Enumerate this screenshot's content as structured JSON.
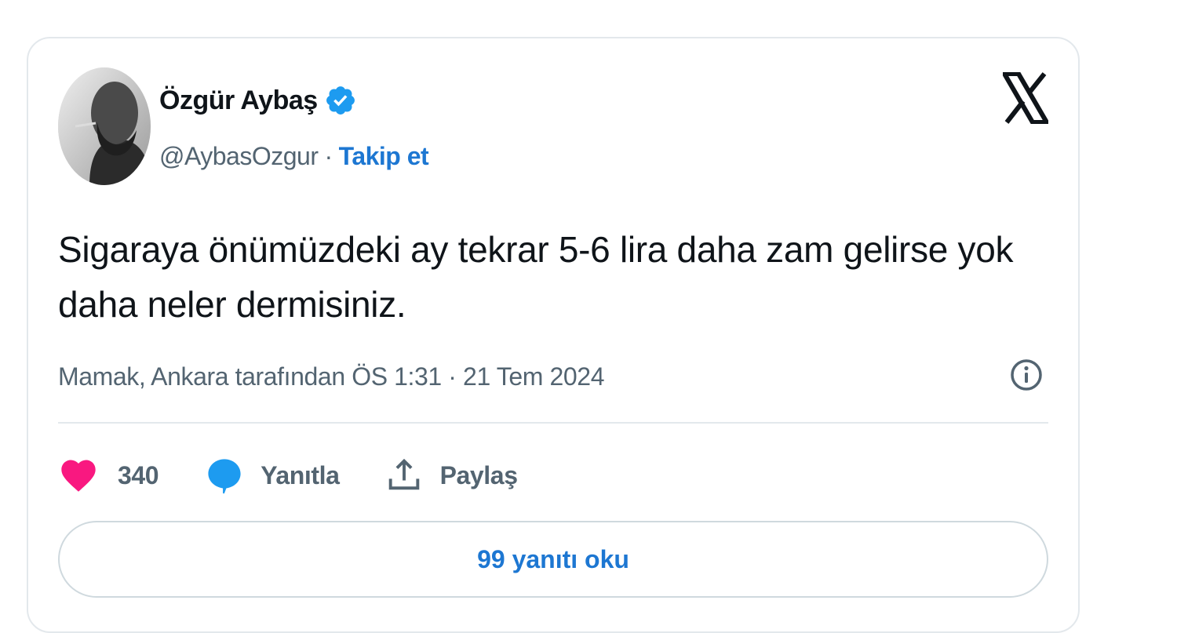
{
  "author": {
    "display_name": "Özgür Aybaş",
    "handle": "@AybasOzgur",
    "separator": "·",
    "follow_label": "Takip et"
  },
  "tweet": {
    "text": "Sigaraya önümüzdeki ay tekrar 5-6 lira daha zam gelirse yok daha neler dermisiniz.",
    "meta": "Mamak, Ankara tarafından ÖS 1:31 · 21 Tem 2024"
  },
  "actions": {
    "like_count": "340",
    "reply_label": "Yanıtla",
    "share_label": "Paylaş"
  },
  "read_replies_label": "99 yanıtı oku",
  "icons": {
    "platform_logo": "x-logo-icon",
    "verified": "verified-badge-icon",
    "info": "info-icon",
    "like": "heart-icon",
    "reply": "speech-bubble-icon",
    "share": "share-upload-icon"
  },
  "colors": {
    "accent": "#1d77d2",
    "verified_badge": "#1d9bf0",
    "like": "#f91880",
    "reply": "#1d9bf0",
    "text_primary": "#0f1419",
    "text_secondary": "#536471",
    "border": "#e3e8ec"
  }
}
